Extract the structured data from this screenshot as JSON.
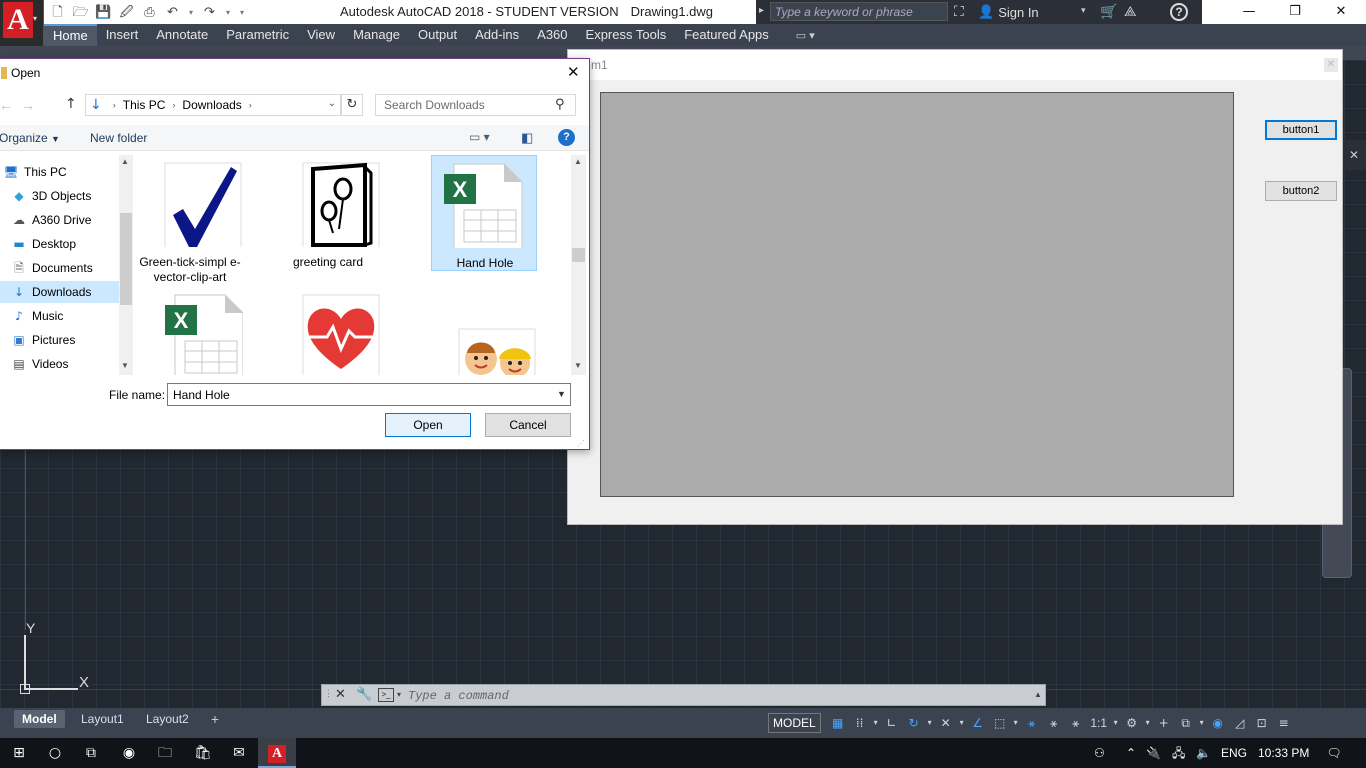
{
  "app": {
    "title": "Autodesk AutoCAD 2018 - STUDENT VERSION",
    "document": "Drawing1.dwg",
    "search_placeholder": "Type a keyword or phrase",
    "sign_in": "Sign In"
  },
  "ribbon": {
    "tabs": [
      "Home",
      "Insert",
      "Annotate",
      "Parametric",
      "View",
      "Manage",
      "Output",
      "Add-ins",
      "A360",
      "Express Tools",
      "Featured Apps"
    ],
    "active_tab": "Home"
  },
  "form": {
    "title_fragment": "m1",
    "button1": "button1",
    "button2": "button2",
    "picture_bg": "#ababab"
  },
  "open_dialog": {
    "title": "Open",
    "path": [
      "This PC",
      "Downloads"
    ],
    "search_placeholder": "Search Downloads",
    "toolbar": {
      "organize": "Organize",
      "new_folder": "New folder"
    },
    "nav_items": [
      {
        "label": "This PC",
        "icon": "computer-icon",
        "selected": false
      },
      {
        "label": "3D Objects",
        "icon": "cube-icon",
        "selected": false
      },
      {
        "label": "A360 Drive",
        "icon": "cloud-drive-icon",
        "selected": false
      },
      {
        "label": "Desktop",
        "icon": "desktop-icon",
        "selected": false
      },
      {
        "label": "Documents",
        "icon": "document-icon",
        "selected": false
      },
      {
        "label": "Downloads",
        "icon": "download-arrow-icon",
        "selected": true
      },
      {
        "label": "Music",
        "icon": "music-note-icon",
        "selected": false
      },
      {
        "label": "Pictures",
        "icon": "picture-icon",
        "selected": false
      },
      {
        "label": "Videos",
        "icon": "film-icon",
        "selected": false
      }
    ],
    "files": [
      {
        "name": "Green-tick-simpl e-vector-clip-art",
        "thumb": "checkmark",
        "selected": false
      },
      {
        "name": "greeting card",
        "thumb": "greeting-card",
        "selected": false
      },
      {
        "name": "Hand Hole",
        "thumb": "excel",
        "selected": true
      },
      {
        "name": "",
        "thumb": "excel",
        "selected": false
      },
      {
        "name": "",
        "thumb": "heart",
        "selected": false
      },
      {
        "name": "",
        "thumb": "kids",
        "selected": false
      }
    ],
    "filename_label": "File name:",
    "filename_value": "Hand Hole",
    "open_label": "Open",
    "cancel_label": "Cancel"
  },
  "command_line": {
    "placeholder": "Type a command"
  },
  "ucs": {
    "x_label": "X",
    "y_label": "Y"
  },
  "status": {
    "layout_tabs": [
      "Model",
      "Layout1",
      "Layout2"
    ],
    "model_label": "MODEL",
    "scale": "1:1"
  },
  "taskbar": {
    "language": "ENG",
    "time": "10:33 PM"
  },
  "colors": {
    "canvas_bg": "#212830",
    "ribbon_bg": "#3c4350",
    "accent": "#0078d7",
    "autocad_red": "#d41f26",
    "selection": "#cce8ff"
  }
}
